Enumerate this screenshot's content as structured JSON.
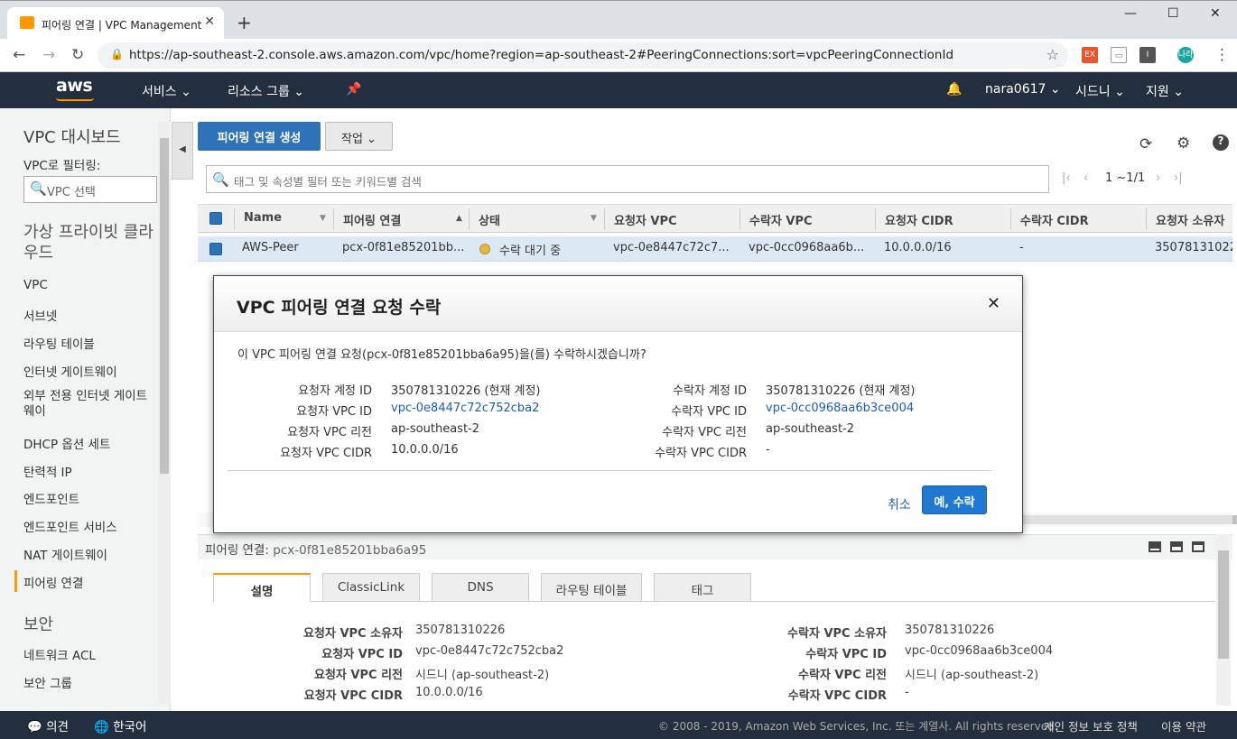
{
  "browser": {
    "tab_title": "피어링 연결 | VPC Management",
    "url": "https://ap-southeast-2.console.aws.amazon.com/vpc/home?region=ap-southeast-2#PeeringConnections:sort=vpcPeeringConnectionId",
    "ext_ex": "EX",
    "ext_profile": "나라"
  },
  "topnav": {
    "logo": "aws",
    "services": "서비스",
    "resource_groups": "리소스 그룹",
    "user": "nara0617",
    "region": "시드니",
    "support": "지원"
  },
  "sidebar": {
    "dashboard": "VPC 대시보드",
    "filter_label": "VPC로 필터링:",
    "filter_placeholder": "VPC 선택",
    "section_vpc": "가상 프라이빗 클라우드",
    "items": [
      "VPC",
      "서브넷",
      "라우팅 테이블",
      "인터넷 게이트웨이",
      "외부 전용 인터넷 게이트웨이",
      "DHCP 옵션 세트",
      "탄력적 IP",
      "엔드포인트",
      "엔드포인트 서비스",
      "NAT 게이트웨이",
      "피어링 연결"
    ],
    "section_security": "보안",
    "security_items": [
      "네트워크 ACL",
      "보안 그룹"
    ]
  },
  "toolbar": {
    "create_button": "피어링 연결 생성",
    "actions_button": "작업",
    "search_placeholder": "태그 및 속성별 필터 또는 키워드별 검색",
    "pager": "1 ~1/1"
  },
  "grid": {
    "columns": [
      "Name",
      "피어링 연결",
      "상태",
      "요청자 VPC",
      "수락자 VPC",
      "요청자 CIDR",
      "수락자 CIDR",
      "요청자 소유자"
    ],
    "row": {
      "name": "AWS-Peer",
      "peering": "pcx-0f81e85201bb...",
      "status": "수락 대기 중",
      "requester_vpc": "vpc-0e8447c72c7...",
      "accepter_vpc": "vpc-0cc0968aa6b...",
      "requester_cidr": "10.0.0.0/16",
      "accepter_cidr": "-",
      "requester_owner": "350781310226"
    }
  },
  "modal": {
    "title": "VPC 피어링 연결 요청 수락",
    "question": "이 VPC 피어링 연결 요청(pcx-0f81e85201bba6a95)을(를) 수락하시겠습니까?",
    "left": [
      {
        "k": "요청자 계정 ID",
        "v": "350781310226 (현재 계정)"
      },
      {
        "k": "요청자 VPC ID",
        "v": "vpc-0e8447c72c752cba2"
      },
      {
        "k": "요청자 VPC 리전",
        "v": "ap-southeast-2"
      },
      {
        "k": "요청자 VPC CIDR",
        "v": "10.0.0.0/16"
      }
    ],
    "right": [
      {
        "k": "수락자 계정 ID",
        "v": "350781310226 (현재 계정)"
      },
      {
        "k": "수락자 VPC ID",
        "v": "vpc-0cc0968aa6b3ce004"
      },
      {
        "k": "수락자 VPC 리전",
        "v": "ap-southeast-2"
      },
      {
        "k": "수락자 VPC CIDR",
        "v": "-"
      }
    ],
    "cancel": "취소",
    "accept": "예, 수락"
  },
  "detail": {
    "header_label": "피어링 연결:",
    "header_value": "pcx-0f81e85201bba6a95",
    "tabs": [
      "설명",
      "ClassicLink",
      "DNS",
      "라우팅 테이블",
      "태그"
    ],
    "left": [
      {
        "k": "요청자 VPC 소유자",
        "v": "350781310226"
      },
      {
        "k": "요청자 VPC ID",
        "v": "vpc-0e8447c72c752cba2"
      },
      {
        "k": "요청자 VPC 리전",
        "v": "시드니 (ap-southeast-2)"
      },
      {
        "k": "요청자 VPC CIDR",
        "v": "10.0.0.0/16"
      }
    ],
    "right": [
      {
        "k": "수락자 VPC 소유자",
        "v": "350781310226"
      },
      {
        "k": "수락자 VPC ID",
        "v": "vpc-0cc0968aa6b3ce004"
      },
      {
        "k": "수락자 VPC 리전",
        "v": "시드니 (ap-southeast-2)"
      },
      {
        "k": "수락자 VPC CIDR",
        "v": "-"
      }
    ]
  },
  "footer": {
    "feedback": "의견",
    "language": "한국어",
    "copyright": "© 2008 - 2019, Amazon Web Services, Inc. 또는 계열사. All rights reserved.",
    "privacy": "개인 정보 보호 정책",
    "terms": "이용 약관"
  }
}
